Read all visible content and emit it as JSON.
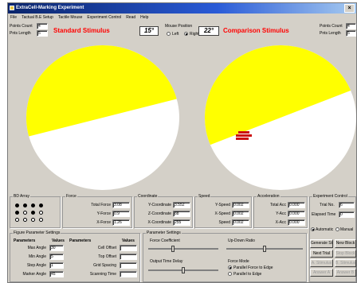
{
  "window": {
    "title": "ExtraCell-Marking Experiment"
  },
  "menu": [
    "File",
    "Tactual B.E Setup",
    "Tactile Mouse",
    "Experiment Control",
    "Read",
    "Help"
  ],
  "header": {
    "left_probe": {
      "point_count_label": "Points Count",
      "point_count_value": "4",
      "points_length_label": "Pnts Length",
      "points_length_value": "5"
    },
    "standard_title": "Standard Stimulus",
    "standard_angle": "15°",
    "mouse_position": {
      "label": "Mouse Position",
      "left_label": "Left",
      "right_label": "Right",
      "selected": "Right"
    },
    "comparison_angle": "22°",
    "comparison_title": "Comparison Stimulus",
    "right_probe": {
      "point_count_label": "Points Count",
      "point_count_value": "4",
      "points_length_label": "Pnts Length",
      "points_length_value": "5"
    }
  },
  "stimuli": {
    "colors": {
      "wedge": "#ffff00",
      "disc": "#ffffff",
      "marker": "#cc1111"
    },
    "standard_angle_deg": 15,
    "comparison_angle_deg": 22
  },
  "pin_array": {
    "title": "BD Array",
    "rows": [
      [
        "f",
        "f",
        "f",
        "f"
      ],
      [
        "f",
        "o",
        "f",
        "o"
      ],
      [
        "o",
        "o",
        "o",
        "o"
      ]
    ]
  },
  "forces": {
    "title": "Force",
    "items": [
      {
        "label": "Total Force",
        "value": "3.08"
      },
      {
        "label": "Y-Force",
        "value": "0.9"
      },
      {
        "label": "X-Force",
        "value": "1.26"
      }
    ]
  },
  "coordinates": {
    "title": "Coordinate",
    "items": [
      {
        "label": "Y-Coordinate",
        "value": "3.552"
      },
      {
        "label": "Z-Coordinate",
        "value": "88"
      },
      {
        "label": "X-Coordinate",
        "value": "255"
      }
    ]
  },
  "speed": {
    "title": "Speed",
    "items": [
      {
        "label": "Y-Speed",
        "value": "0.002"
      },
      {
        "label": "X-Speed",
        "value": "0.002"
      },
      {
        "label": "Speed",
        "value": "0.002"
      }
    ]
  },
  "acceleration": {
    "title": "Acceleration",
    "items": [
      {
        "label": "Total Acc",
        "value": "0.000"
      },
      {
        "label": "Y-Acc",
        "value": "0.000"
      },
      {
        "label": "X-Acc",
        "value": "0.000"
      }
    ]
  },
  "experiment_control": {
    "title": "Experiment Control",
    "trial_label": "Trial No.",
    "trial_value": "6",
    "elapsed_label": "Elapsed Time",
    "elapsed_value": "0",
    "mode_auto": "Automatic",
    "mode_manual": "Manual",
    "mode_selected": "Automatic",
    "buttons": [
      {
        "label": "Generate Stim",
        "enabled": true
      },
      {
        "label": "New Block",
        "enabled": true
      },
      {
        "label": "Next Trial",
        "enabled": true
      },
      {
        "label": "Stop Block",
        "enabled": false
      },
      {
        "label": "A. Stimulus",
        "enabled": false
      },
      {
        "label": "B. Stimulus",
        "enabled": false
      },
      {
        "label": "Answer A",
        "enabled": false
      },
      {
        "label": "Answer B",
        "enabled": false
      }
    ]
  },
  "figure_params": {
    "title": "Figure Parameter Settings",
    "col1_header": "Parameters",
    "col1_values_header": "Values",
    "col1": [
      {
        "label": "Max Angle",
        "value": "30"
      },
      {
        "label": "Min Angle",
        "value": "5"
      },
      {
        "label": "Step Angle",
        "value": "1"
      },
      {
        "label": "Marker Angle",
        "value": "45"
      }
    ],
    "col2_header": "Parameters",
    "col2_values_header": "Values",
    "col2": [
      {
        "label": "Cell Offset",
        "value": ""
      },
      {
        "label": "Top Offset",
        "value": ""
      },
      {
        "label": "Grid Spacing",
        "value": ""
      },
      {
        "label": "Scanning Time",
        "value": ""
      }
    ]
  },
  "parameter_settings": {
    "title": "Parameter Settings",
    "force_coefficient": "Force Coefficient",
    "up_down_ratio": "Up-Down Ratio",
    "output_time_delay": "Output Time Delay",
    "force_mode": "Force Mode",
    "mode_a": "Parallel Force to Edge",
    "mode_b": "Parallel to Edge",
    "mode_selected": "a",
    "sliders": {
      "force_coefficient": 0.35,
      "up_down_ratio": 0.5,
      "output_time_delay": 0.5
    }
  }
}
